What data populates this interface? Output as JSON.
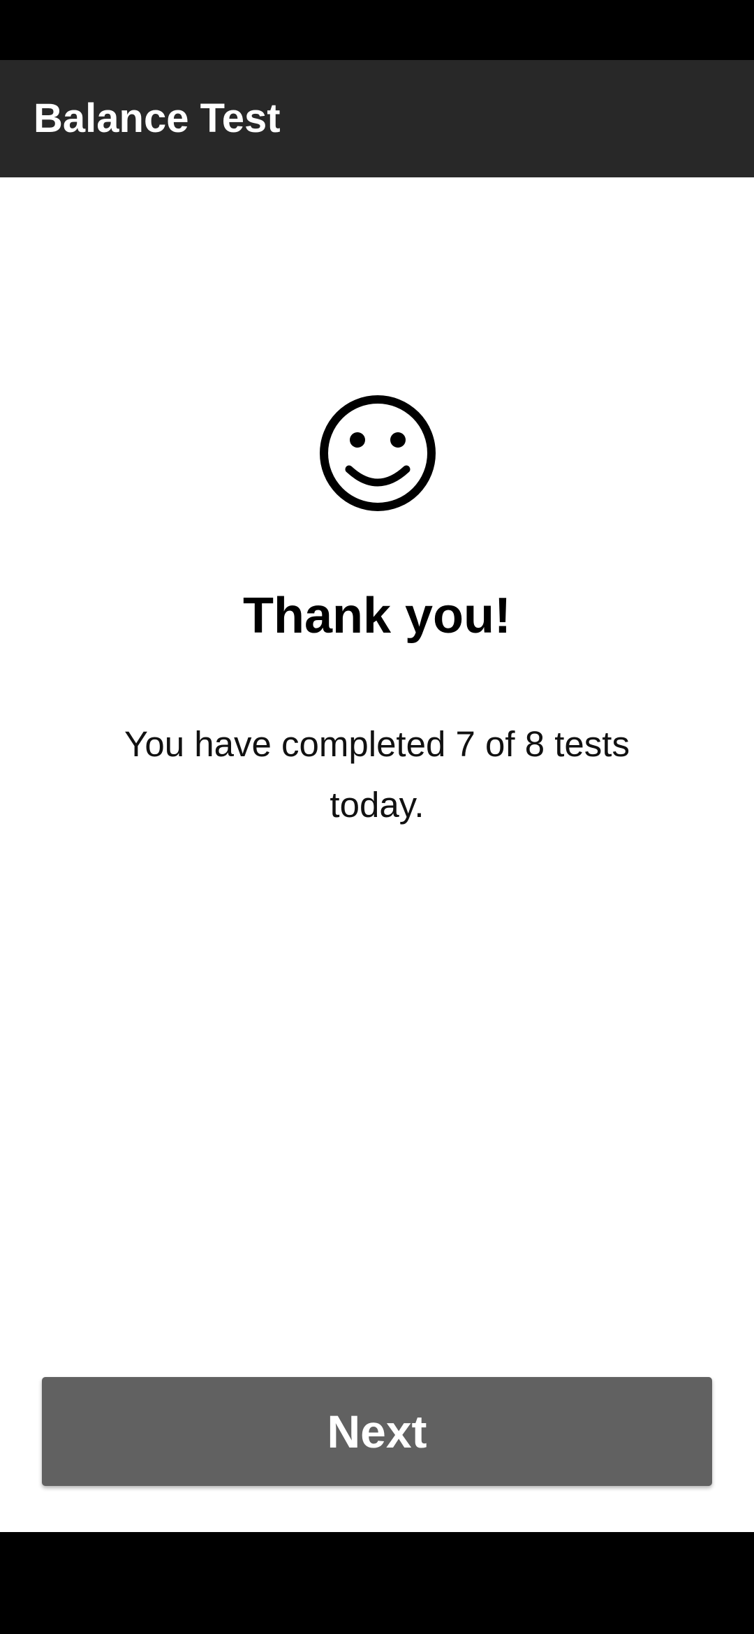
{
  "app_bar": {
    "title": "Balance Test",
    "background": "#282828"
  },
  "completion": {
    "icon": "smiley-face-icon",
    "heading": "Thank you!",
    "message": "You have completed 7 of 8 tests today.",
    "tests_completed": 7,
    "tests_total": 8
  },
  "actions": {
    "next_label": "Next",
    "button_color": "#616161"
  }
}
